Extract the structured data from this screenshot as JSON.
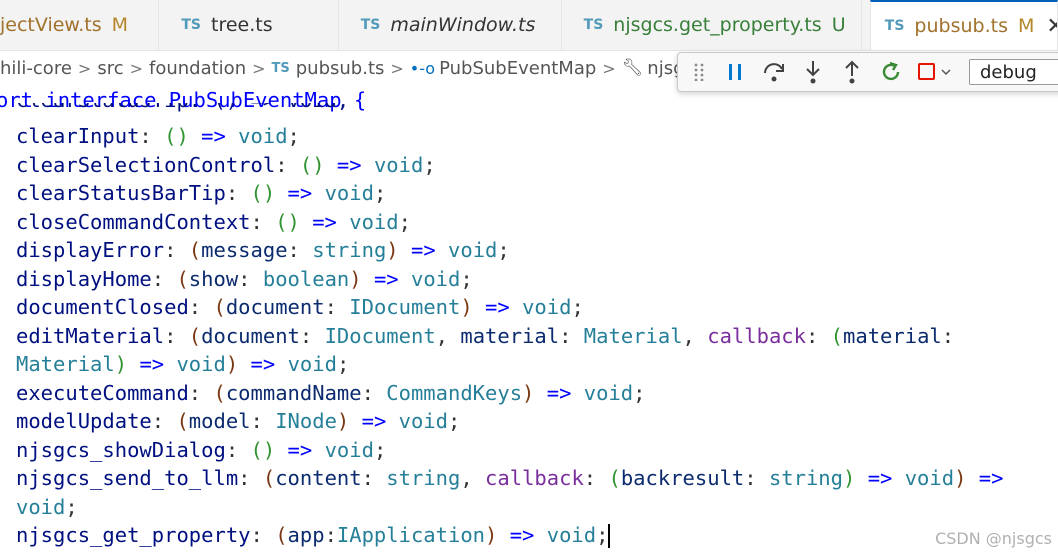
{
  "tabs": [
    {
      "label": "jectView.ts",
      "status": "M",
      "kind": "modified"
    },
    {
      "icon": "TS",
      "label": "tree.ts",
      "status": "",
      "kind": "normal"
    },
    {
      "icon": "TS",
      "label": "mainWindow.ts",
      "status": "",
      "kind": "italic"
    },
    {
      "icon": "TS",
      "label": "njsgcs.get_property.ts",
      "status": "U",
      "kind": "untracked"
    },
    {
      "icon": "TS",
      "label": "pubsub.ts",
      "status": "M",
      "kind": "active"
    }
  ],
  "close_glyph": "✕",
  "breadcrumb": {
    "items": [
      "hili-core",
      "src",
      "foundation",
      "pubsub.ts",
      "PubSubEventMap",
      "njsg"
    ],
    "ts_icon": "TS"
  },
  "debug_toolbar": {
    "config": "debug",
    "colors": {
      "pause": "#007acc",
      "step": "#424242",
      "restart": "#388a34",
      "stop": "#e51400"
    }
  },
  "code": {
    "header_partial": "ort interface PubSubEventMap {",
    "clipped_line": "clearStatusTip: () => void;"
  },
  "watermark": "CSDN @njsgcs"
}
